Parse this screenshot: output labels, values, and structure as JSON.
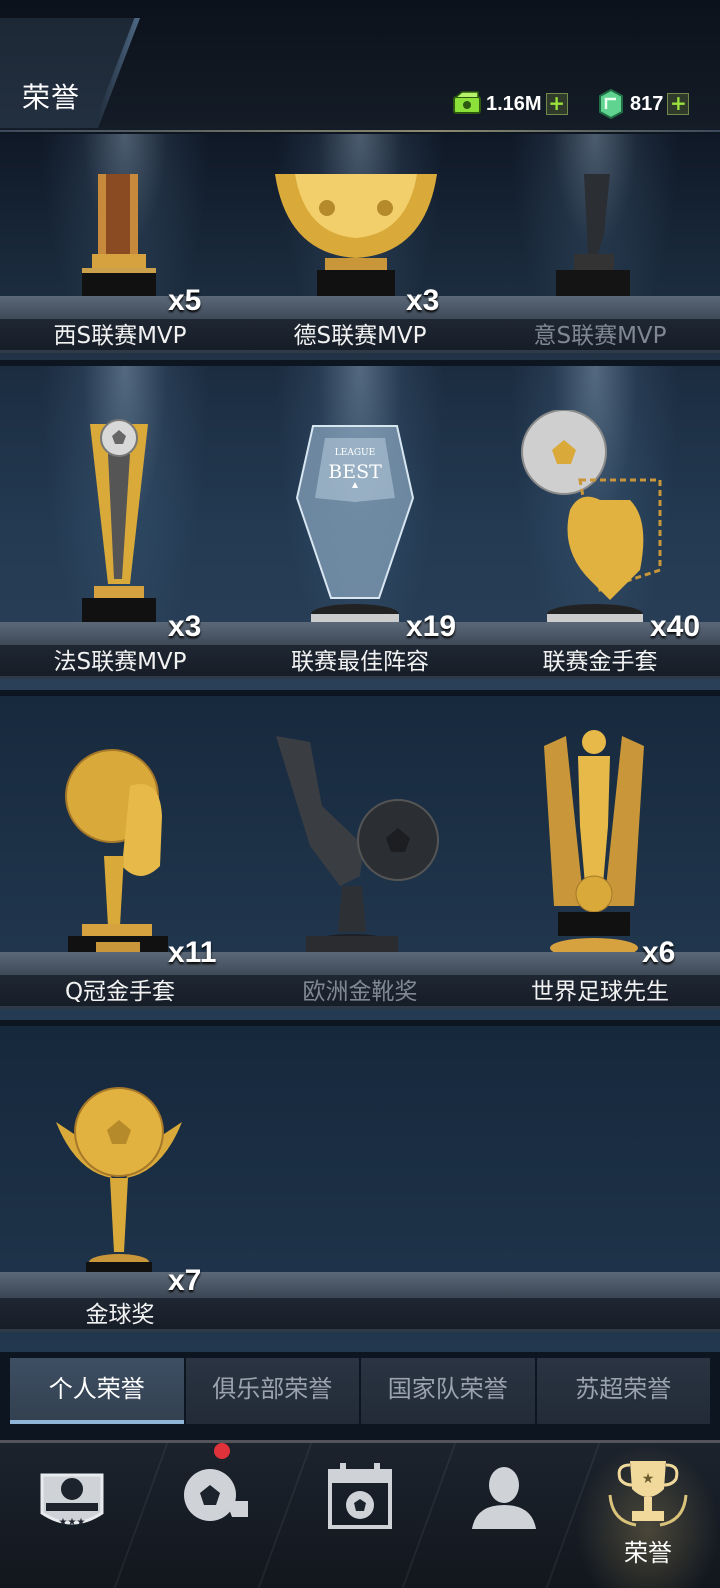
{
  "header": {
    "title": "荣誉",
    "cash": {
      "value": "1.16M",
      "icon": "cash-icon",
      "plus": "+"
    },
    "gems": {
      "value": "817",
      "icon": "gem-icon",
      "plus": "+"
    }
  },
  "shelves": [
    {
      "items": [
        {
          "name": "西S联赛MVP",
          "count": "x5",
          "owned": true
        },
        {
          "name": "德S联赛MVP",
          "count": "x3",
          "owned": true
        },
        {
          "name": "意S联赛MVP",
          "count": "",
          "owned": false
        }
      ]
    },
    {
      "items": [
        {
          "name": "法S联赛MVP",
          "count": "x3",
          "owned": true
        },
        {
          "name": "联赛最佳阵容",
          "count": "x19",
          "owned": true,
          "engraving": {
            "top": "LEAGUE",
            "main": "BEST"
          }
        },
        {
          "name": "联赛金手套",
          "count": "x40",
          "owned": true
        }
      ]
    },
    {
      "items": [
        {
          "name": "Q冠金手套",
          "count": "x11",
          "owned": true
        },
        {
          "name": "欧洲金靴奖",
          "count": "",
          "owned": false
        },
        {
          "name": "世界足球先生",
          "count": "x6",
          "owned": true
        }
      ]
    },
    {
      "items": [
        {
          "name": "金球奖",
          "count": "x7",
          "owned": true
        }
      ]
    }
  ],
  "tabs": [
    {
      "label": "个人荣誉",
      "active": true
    },
    {
      "label": "俱乐部荣誉",
      "active": false
    },
    {
      "label": "国家队荣誉",
      "active": false
    },
    {
      "label": "苏超荣誉",
      "active": false
    }
  ],
  "bottom_nav": [
    {
      "icon": "club-crest-icon",
      "label": ""
    },
    {
      "icon": "ball-whistle-icon",
      "label": "",
      "badge": true
    },
    {
      "icon": "calendar-icon",
      "label": ""
    },
    {
      "icon": "player-icon",
      "label": ""
    },
    {
      "icon": "trophy-icon",
      "label": "荣誉",
      "active": true
    }
  ],
  "colors": {
    "gold": "#d9a93a",
    "accent_green": "#9be33c",
    "badge_red": "#e0323a",
    "tab_active_line": "#8fb6d8"
  }
}
